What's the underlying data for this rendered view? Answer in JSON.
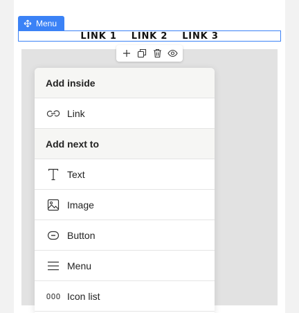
{
  "menu_tag": {
    "label": "Menu",
    "icon": "move-icon",
    "color": "#3b82f6"
  },
  "menu_bar": {
    "links": [
      "LINK 1",
      "LINK 2",
      "LINK 3"
    ]
  },
  "toolbar": {
    "icons": [
      "plus-icon",
      "duplicate-icon",
      "trash-icon",
      "eye-icon"
    ]
  },
  "panel": {
    "add_inside": {
      "title": "Add inside",
      "items": [
        {
          "label": "Link",
          "icon": "link-icon"
        }
      ]
    },
    "add_next_to": {
      "title": "Add next to",
      "items": [
        {
          "label": "Text",
          "icon": "text-icon"
        },
        {
          "label": "Image",
          "icon": "image-icon"
        },
        {
          "label": "Button",
          "icon": "button-icon"
        },
        {
          "label": "Menu",
          "icon": "menu-icon"
        },
        {
          "label": "Icon list",
          "icon": "icon-list-icon"
        }
      ]
    }
  }
}
